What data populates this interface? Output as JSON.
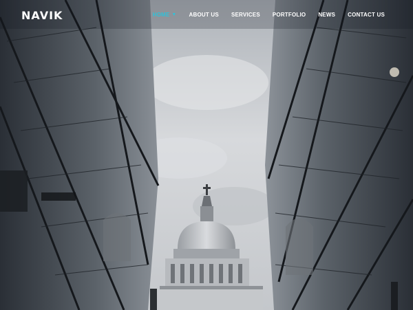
{
  "brand": {
    "logo_text": "NAVIK"
  },
  "nav": {
    "items": [
      {
        "label": "HOME",
        "active": true,
        "has_dropdown": true
      },
      {
        "label": "ABOUT US"
      },
      {
        "label": "SERVICES"
      },
      {
        "label": "PORTFOLIO"
      },
      {
        "label": "NEWS"
      },
      {
        "label": "CONTACT US"
      }
    ]
  },
  "colors": {
    "accent": "#30c1d8",
    "nav_text": "#ffffff",
    "sky": "#c9ccd0"
  },
  "hero": {
    "image_subject": "glass-buildings-framing-domed-cathedral"
  }
}
